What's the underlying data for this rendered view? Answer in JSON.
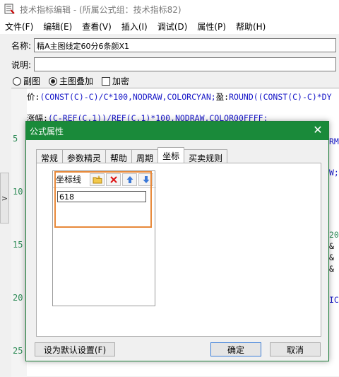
{
  "window": {
    "title": "技术指标编辑 - (所属公式组：技术指标82)"
  },
  "menu": [
    "文件(F)",
    "编辑(E)",
    "查看(V)",
    "插入(I)",
    "调试(D)",
    "属性(P)",
    "帮助(H)"
  ],
  "form": {
    "name_label": "名称:",
    "name_value": "精A主图线定60分6条颜X1",
    "desc_label": "说明:",
    "desc_value": "",
    "radio_sub": "副图",
    "radio_main": "主图叠加",
    "encrypt": "加密"
  },
  "editor": {
    "line_numbers": [
      "5",
      "10",
      "15",
      "20",
      "25"
    ],
    "line1": {
      "a": "价:",
      "b": "(CONST(C)-C)/C*100,NODRAW,COLORCYAN;",
      "c": "盈:",
      "d": "ROUND((CONST(C)-C)*DY"
    },
    "line2": {
      "a": "涨幅:",
      "b": "(C-REF(C,1))/REF(C,1)*100,NODRAW,COLOR00FFFF;"
    },
    "edge": [
      "RM",
      "W;",
      "20",
      "&",
      "&",
      "&",
      "IC"
    ]
  },
  "dialog": {
    "title": "公式属性",
    "close": "✕",
    "tabs": [
      "常规",
      "参数精灵",
      "帮助",
      "周期",
      "坐标",
      "买卖规则"
    ],
    "group_label": "坐标线",
    "list_value": "618",
    "btn_default": "设为默认设置(F)",
    "btn_ok": "确定",
    "btn_cancel": "取消"
  },
  "colors": {
    "dialog_title_bg": "#1a8a3a",
    "highlight": "#e8893a",
    "line_number": "#2e8b57"
  }
}
